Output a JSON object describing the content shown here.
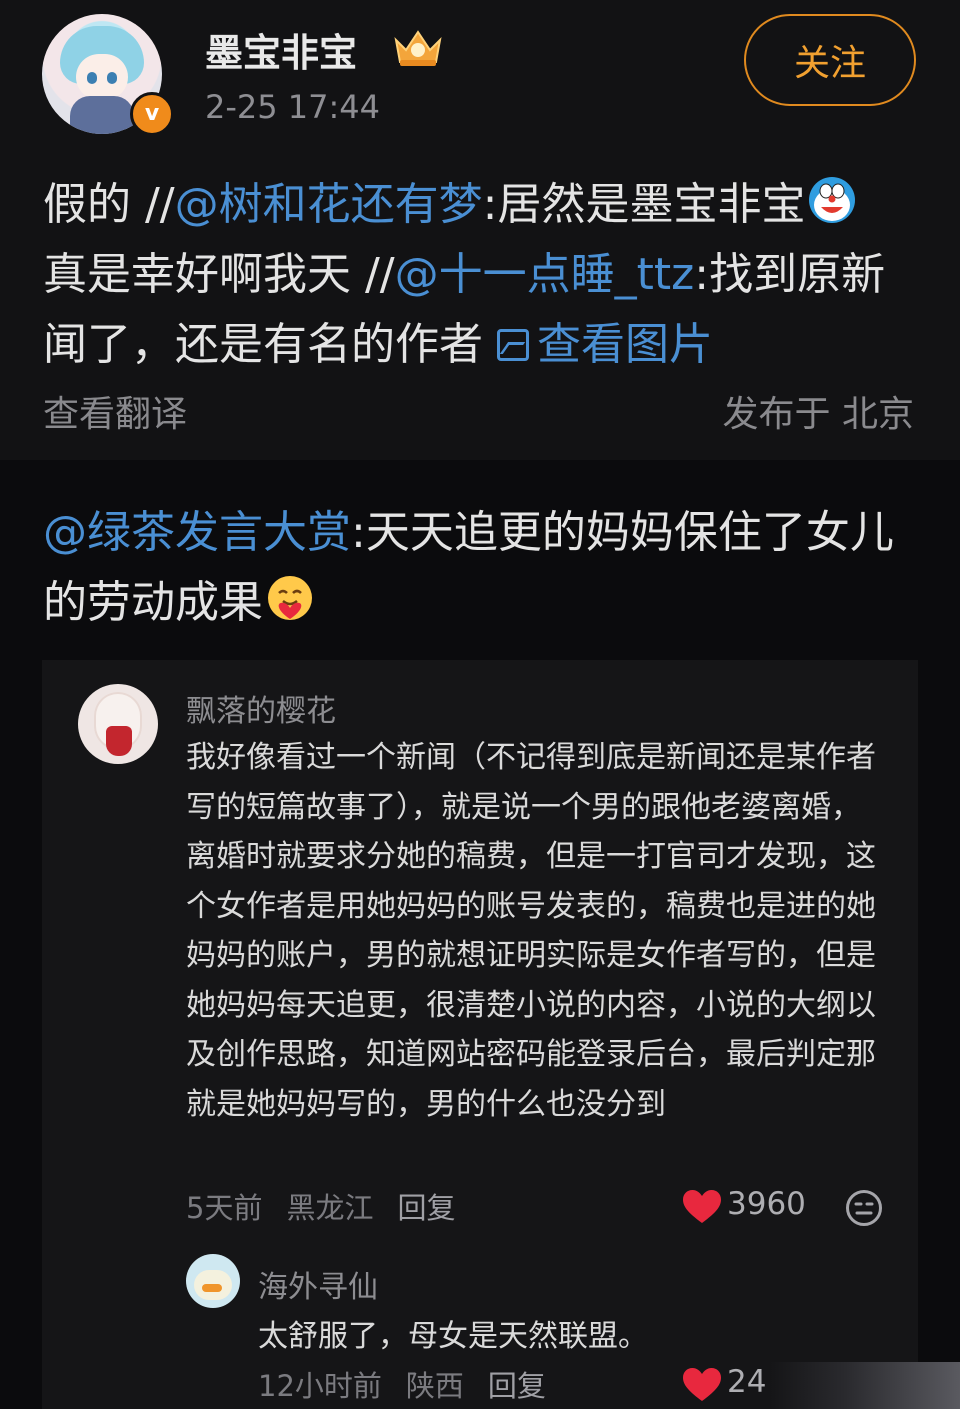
{
  "post": {
    "username": "墨宝非宝",
    "time": "2-25 17:44",
    "follow_label": "关注",
    "text_parts": {
      "p1": "假的 //",
      "m1": "@树和花还有梦",
      "p2": ":居然是墨宝非宝",
      "p3": "真是幸好啊我天 //",
      "m2": "@十一点睡_ttz",
      "p4": ":找到原新闻了，还是有名的作者 ",
      "view_image": "查看图片"
    },
    "translate_label": "查看翻译",
    "location": "发布于 北京"
  },
  "repost": {
    "mention": "@绿茶发言大赏",
    "text": ":天天追更的妈妈保住了女儿的劳动成果"
  },
  "comments": [
    {
      "author": "飘落的樱花",
      "text": "我好像看过一个新闻（不记得到底是新闻还是某作者写的短篇故事了），就是说一个男的跟他老婆离婚，离婚时就要求分她的稿费，但是一打官司才发现，这个女作者是用她妈妈的账号发表的，稿费也是进的她妈妈的账户，男的就想证明实际是女作者写的，但是她妈妈每天追更，很清楚小说的内容，小说的大纲以及创作思路，知道网站密码能登录后台，最后判定那就是她妈妈写的，男的什么也没分到",
      "time": "5天前",
      "region": "黑龙江",
      "reply_label": "回复",
      "likes": "3960"
    },
    {
      "author": "海外寻仙",
      "text": "太舒服了，母女是天然联盟。",
      "time": "12小时前",
      "region": "陕西",
      "reply_label": "回复",
      "likes": "24"
    }
  ],
  "icons": {
    "verified": "v-badge",
    "crown": "crown-icon",
    "doraemon": "doraemon-emoji",
    "hug": "hug-emoji",
    "image": "image-icon",
    "heart": "heart-icon",
    "smile": "smile-icon"
  },
  "colors": {
    "background": "#0b0b0d",
    "panel": "#121214",
    "card": "#151517",
    "link": "#4a8fd3",
    "accent": "#f1a030",
    "heart": "#e8283e"
  }
}
